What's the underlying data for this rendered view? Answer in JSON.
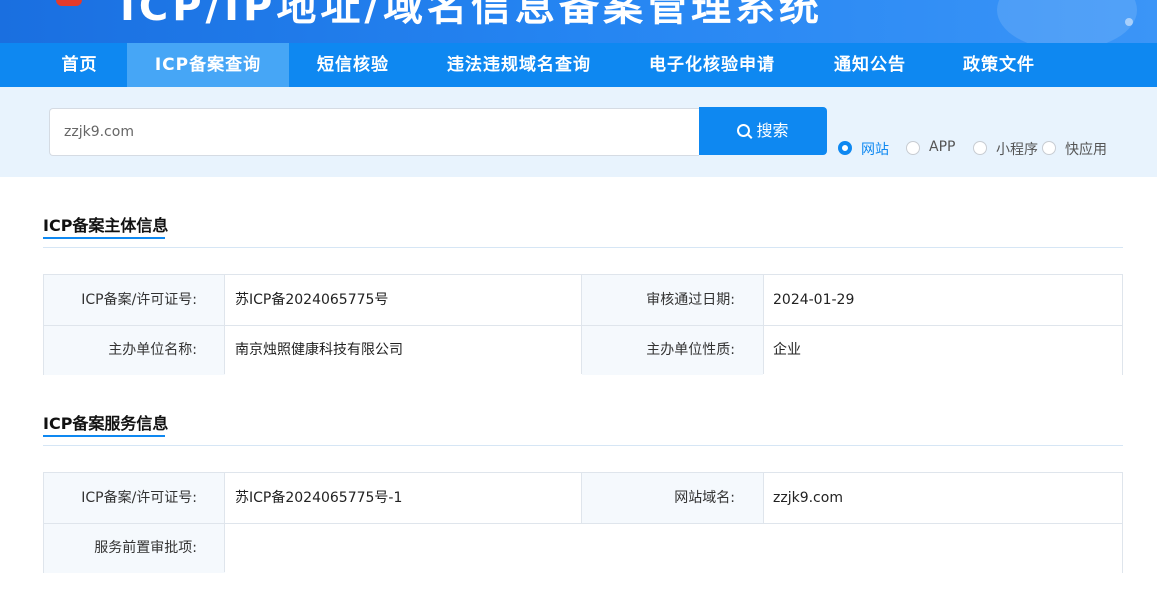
{
  "header": {
    "title": "ICP/IP地址/域名信息备案管理系统"
  },
  "nav": {
    "items": [
      {
        "label": "首页"
      },
      {
        "label": "ICP备案查询",
        "active": true
      },
      {
        "label": "短信核验"
      },
      {
        "label": "违法违规域名查询"
      },
      {
        "label": "电子化核验申请"
      },
      {
        "label": "通知公告"
      },
      {
        "label": "政策文件"
      }
    ]
  },
  "search": {
    "value": "zzjk9.com",
    "button_label": "搜索",
    "types": [
      {
        "label": "网站",
        "checked": true
      },
      {
        "label": "APP",
        "checked": false
      },
      {
        "label": "小程序",
        "checked": false
      },
      {
        "label": "快应用",
        "checked": false
      }
    ]
  },
  "subject": {
    "title": "ICP备案主体信息",
    "license_label": "ICP备案/许可证号:",
    "license_value": "苏ICP备2024065775号",
    "date_label": "审核通过日期:",
    "date_value": "2024-01-29",
    "org_label": "主办单位名称:",
    "org_value": "南京烛照健康科技有限公司",
    "nature_label": "主办单位性质:",
    "nature_value": "企业"
  },
  "service": {
    "title": "ICP备案服务信息",
    "license_label": "ICP备案/许可证号:",
    "license_value": "苏ICP备2024065775号-1",
    "domain_label": "网站域名:",
    "domain_value": "zzjk9.com",
    "approval_label": "服务前置审批项:",
    "approval_value": ""
  },
  "colors": {
    "primary": "#0e88f1",
    "nav_active": "#46a6f6",
    "search_band": "#e8f3fd"
  }
}
